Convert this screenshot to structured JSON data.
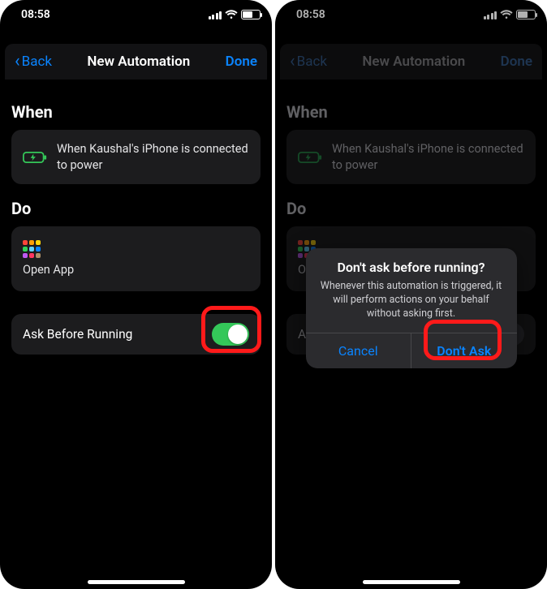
{
  "statusbar": {
    "time": "08:58"
  },
  "nav": {
    "back": "Back",
    "title": "New Automation",
    "done": "Done"
  },
  "sections": {
    "when": "When",
    "do": "Do"
  },
  "when_card": {
    "text": "When Kaushal's iPhone is connected to power"
  },
  "do_card": {
    "label": "Open App"
  },
  "ask_row": {
    "label": "Ask Before Running"
  },
  "dialog": {
    "title": "Don't ask before running?",
    "message": "Whenever this automation is triggered, it will perform actions on your behalf without asking first.",
    "cancel": "Cancel",
    "confirm": "Don't Ask"
  },
  "screen2": {
    "do_card_label_truncated": "Op",
    "ask_row_label_truncated": "Ask"
  }
}
